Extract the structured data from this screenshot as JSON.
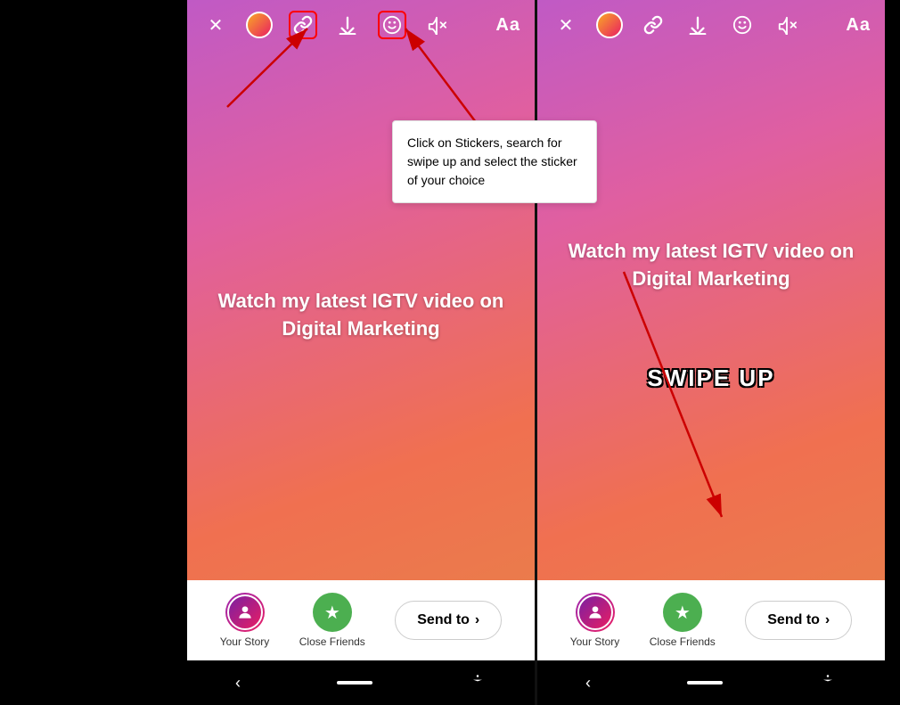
{
  "left_phone": {
    "toolbar": {
      "close_icon": "✕",
      "avatar_label": "user-avatar",
      "link_icon": "🔗",
      "download_icon": "⬇",
      "sticker_icon": "😊",
      "mute_icon": "🔇",
      "font_btn": "Aa"
    },
    "story_text": "Watch my latest IGTV video on Digital Marketing",
    "bottom_bar": {
      "your_story_label": "Your Story",
      "close_friends_label": "Close Friends",
      "send_to_label": "Send to",
      "send_to_arrow": "›"
    },
    "nav": {
      "back": "‹",
      "home": "",
      "accessibility": "♿"
    }
  },
  "right_phone": {
    "toolbar": {
      "close_icon": "✕",
      "link_icon": "🔗",
      "download_icon": "⬇",
      "sticker_icon": "😊",
      "mute_icon": "🔇",
      "font_btn": "Aa"
    },
    "story_text": "Watch my latest IGTV video on Digital Marketing",
    "swipe_up_text": "SWIPE UP",
    "bottom_bar": {
      "your_story_label": "Your Story",
      "close_friends_label": "Close Friends",
      "send_to_label": "Send to",
      "send_to_arrow": "›"
    },
    "nav": {
      "back": "‹",
      "home": "",
      "accessibility": "♿"
    }
  },
  "tooltip": {
    "text": "Click on Stickers, search for swipe up and select the sticker of your choice"
  },
  "colors": {
    "gradient_start": "#c05ac5",
    "gradient_mid": "#e05fa0",
    "gradient_end": "#e8804a",
    "highlight_red": "#ff0000",
    "white": "#ffffff",
    "black": "#000000"
  }
}
